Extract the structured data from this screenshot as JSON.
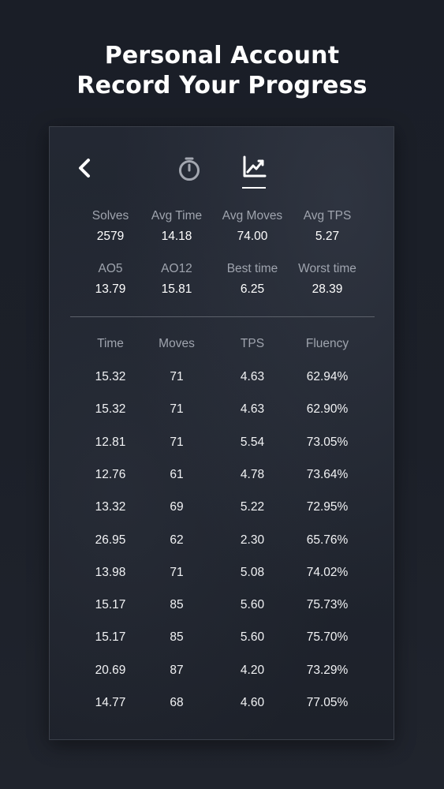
{
  "headline": {
    "line1": "Personal Account",
    "line2": "Record Your Progress"
  },
  "toolbar": {
    "back_icon": "chevron-left-icon",
    "timer_icon": "stopwatch-icon",
    "stats_icon": "line-chart-icon",
    "active_tab": "stats"
  },
  "summary": [
    {
      "label": "Solves",
      "value": "2579"
    },
    {
      "label": "Avg Time",
      "value": "14.18"
    },
    {
      "label": "Avg Moves",
      "value": "74.00"
    },
    {
      "label": "Avg TPS",
      "value": "5.27"
    },
    {
      "label": "AO5",
      "value": "13.79"
    },
    {
      "label": "AO12",
      "value": "15.81"
    },
    {
      "label": "Best time",
      "value": "6.25"
    },
    {
      "label": "Worst time",
      "value": "28.39"
    }
  ],
  "table": {
    "columns": [
      "Time",
      "Moves",
      "TPS",
      "Fluency"
    ],
    "rows": [
      [
        "15.32",
        "71",
        "4.63",
        "62.94%"
      ],
      [
        "15.32",
        "71",
        "4.63",
        "62.90%"
      ],
      [
        "12.81",
        "71",
        "5.54",
        "73.05%"
      ],
      [
        "12.76",
        "61",
        "4.78",
        "73.64%"
      ],
      [
        "13.32",
        "69",
        "5.22",
        "72.95%"
      ],
      [
        "26.95",
        "62",
        "2.30",
        "65.76%"
      ],
      [
        "13.98",
        "71",
        "5.08",
        "74.02%"
      ],
      [
        "15.17",
        "85",
        "5.60",
        "75.73%"
      ],
      [
        "15.17",
        "85",
        "5.60",
        "75.70%"
      ],
      [
        "20.69",
        "87",
        "4.20",
        "73.29%"
      ],
      [
        "14.77",
        "68",
        "4.60",
        "77.05%"
      ]
    ]
  },
  "colors": {
    "background": "#1c2029",
    "card": "#222731",
    "label": "#9fa4ae",
    "value": "#ffffff"
  }
}
